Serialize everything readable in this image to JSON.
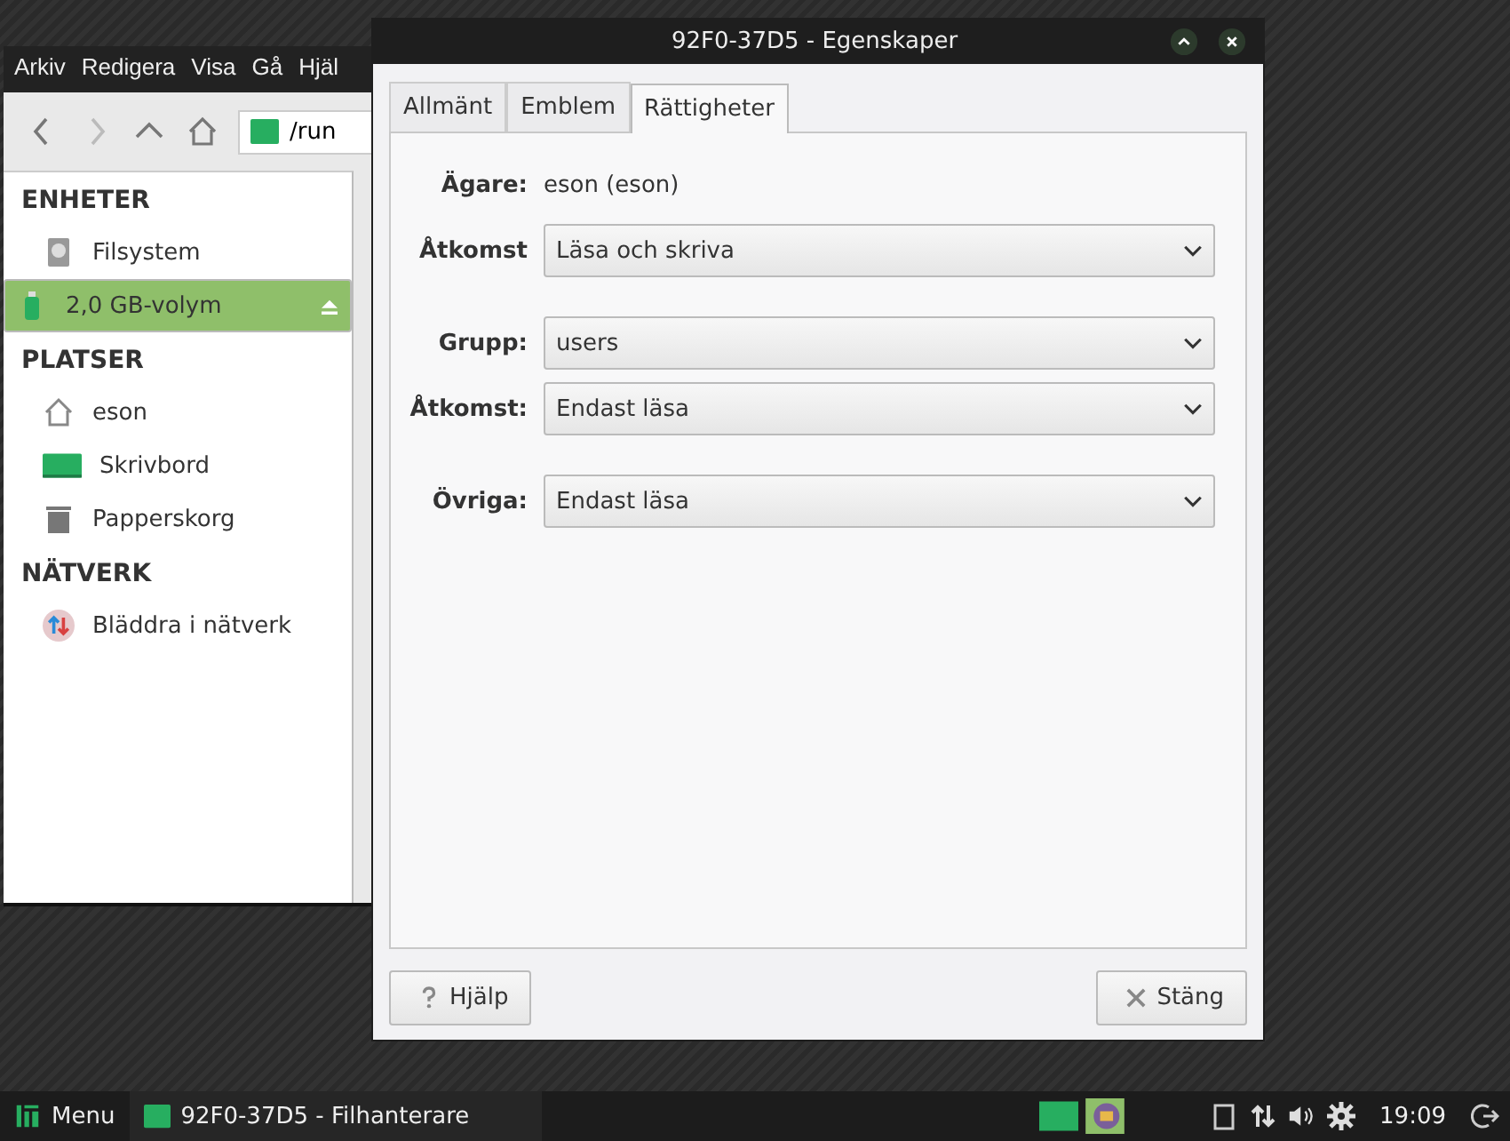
{
  "file_manager": {
    "menu": [
      "Arkiv",
      "Redigera",
      "Visa",
      "Gå",
      "Hjäl"
    ],
    "path": "/run",
    "sidebar": [
      {
        "heading": "ENHETER",
        "items": [
          {
            "label": "Filsystem",
            "selected": false
          },
          {
            "label": "2,0 GB-volym",
            "selected": true,
            "eject": true
          }
        ]
      },
      {
        "heading": "PLATSER",
        "items": [
          {
            "label": "eson",
            "selected": false
          },
          {
            "label": "Skrivbord",
            "selected": false
          },
          {
            "label": "Papperskorg",
            "selected": false
          }
        ]
      },
      {
        "heading": "NÄTVERK",
        "items": [
          {
            "label": "Bläddra i nätverk",
            "selected": false
          }
        ]
      }
    ]
  },
  "dialog": {
    "title": "92F0-37D5 - Egenskaper",
    "tabs": [
      {
        "label": "Allmänt",
        "selected": false
      },
      {
        "label": "Emblem",
        "selected": false
      },
      {
        "label": "Rättigheter",
        "selected": true
      }
    ],
    "groups": [
      [
        {
          "kind": "text",
          "label": "Ägare:",
          "value": "eson (eson)"
        },
        {
          "kind": "select",
          "label": "Åtkomst",
          "value": "Läsa och skriva"
        }
      ],
      [
        {
          "kind": "select",
          "label": "Grupp:",
          "value": "users"
        },
        {
          "kind": "select",
          "label": "Åtkomst:",
          "value": "Endast läsa"
        }
      ],
      [
        {
          "kind": "select",
          "label": "Övriga:",
          "value": "Endast läsa"
        }
      ]
    ],
    "buttons": [
      "Hjälp",
      "Stäng"
    ]
  },
  "taskbar": {
    "menu": "Menu",
    "task": "92F0-37D5 - Filhanterare",
    "clock": "19:09"
  }
}
